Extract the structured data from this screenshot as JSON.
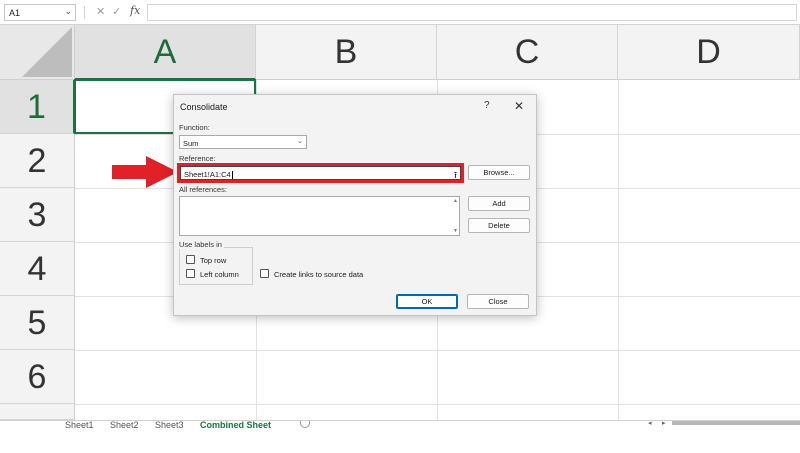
{
  "formula_bar": {
    "name_box": "A1",
    "fx_label": "fx",
    "cancel_glyph": "✕",
    "enter_glyph": "✓",
    "formula": ""
  },
  "columns": [
    "A",
    "B",
    "C",
    "D"
  ],
  "rows": [
    "1",
    "2",
    "3",
    "4",
    "5",
    "6"
  ],
  "sheet_tabs": [
    "Sheet1",
    "Sheet2",
    "Sheet3",
    "Combined Sheet"
  ],
  "active_sheet": "Combined Sheet",
  "dialog": {
    "title": "Consolidate",
    "help": "?",
    "close": "✕",
    "function_label": "Function:",
    "function_value": "Sum",
    "reference_label": "Reference:",
    "reference_value": "Sheet1!A1:C4",
    "browse_label": "Browse...",
    "all_references_label": "All references:",
    "add_label": "Add",
    "delete_label": "Delete",
    "use_labels_label": "Use labels in",
    "top_row_label": "Top row",
    "left_column_label": "Left column",
    "create_links_label": "Create links to source data",
    "ok_label": "OK",
    "close_label": "Close",
    "top_row_checked": false,
    "left_column_checked": false,
    "create_links_checked": false
  },
  "colors": {
    "accent_green": "#1e7145",
    "highlight_red": "#e02127",
    "primary_button_border": "#0067c0"
  },
  "icons": {
    "collapse_dialog": "collapse-dialog-icon",
    "annotation_arrow": "red-arrow-icon"
  }
}
